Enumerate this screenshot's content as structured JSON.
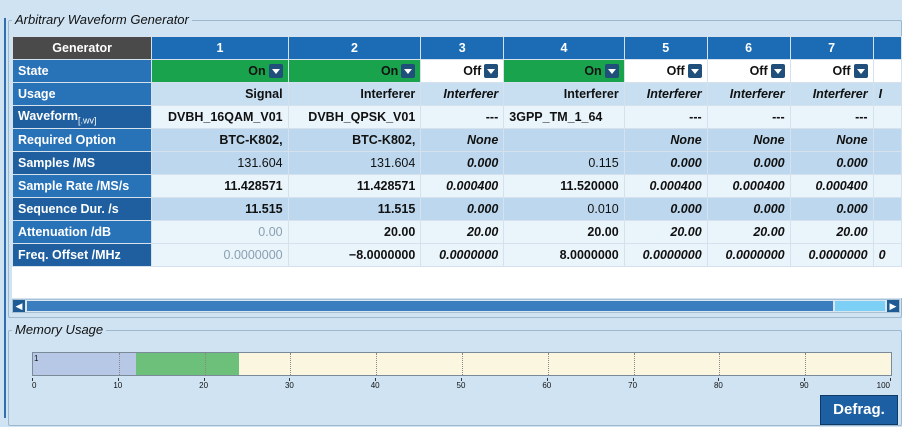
{
  "window": {
    "group_title": "Arbitrary Waveform Generator",
    "memory_title": "Memory Usage",
    "defrag_label": "Defrag."
  },
  "table": {
    "corner": "Generator",
    "columns": [
      "1",
      "2",
      "3",
      "4",
      "5",
      "6",
      "7"
    ],
    "rows": {
      "state": {
        "label": "State",
        "values": [
          "On",
          "On",
          "Off",
          "On",
          "Off",
          "Off",
          "Off"
        ]
      },
      "usage": {
        "label": "Usage",
        "values": [
          "Signal",
          "Interferer",
          "Interferer",
          "Interferer",
          "Interferer",
          "Interferer",
          "Interferer"
        ],
        "partial_next": "I"
      },
      "waveform": {
        "label": "Waveform",
        "label_sub": "[.wv]",
        "values": [
          "DVBH_16QAM_V01",
          "DVBH_QPSK_V01",
          "---",
          "3GPP_TM_1_64",
          "---",
          "---",
          "---"
        ]
      },
      "required_option": {
        "label": "Required Option",
        "values": [
          "BTC-K802,",
          "BTC-K802,",
          "None",
          "",
          "None",
          "None",
          "None"
        ]
      },
      "samples": {
        "label": "Samples /MS",
        "values": [
          "131.604",
          "131.604",
          "0.000",
          "0.115",
          "0.000",
          "0.000",
          "0.000"
        ]
      },
      "sample_rate": {
        "label": "Sample Rate /MS/s",
        "values": [
          "11.428571",
          "11.428571",
          "0.000400",
          "11.520000",
          "0.000400",
          "0.000400",
          "0.000400"
        ]
      },
      "sequence_dur": {
        "label": "Sequence Dur. /s",
        "values": [
          "11.515",
          "11.515",
          "0.000",
          "0.010",
          "0.000",
          "0.000",
          "0.000"
        ]
      },
      "attenuation": {
        "label": "Attenuation /dB",
        "values": [
          "0.00",
          "20.00",
          "20.00",
          "20.00",
          "20.00",
          "20.00",
          "20.00"
        ]
      },
      "freq_offset": {
        "label": "Freq. Offset /MHz",
        "values": [
          "0.0000000",
          "−8.0000000",
          "0.0000000",
          "8.0000000",
          "0.0000000",
          "0.0000000",
          "0.0000000"
        ],
        "partial_next": "0"
      }
    }
  },
  "memory": {
    "segments": [
      {
        "label": "1",
        "from": 0,
        "to": 12,
        "color": "#b7c8e6"
      },
      {
        "label": "",
        "from": 12,
        "to": 24,
        "color": "#6cc07a"
      }
    ],
    "ticks": [
      "0",
      "10",
      "20",
      "30",
      "40",
      "50",
      "60",
      "70",
      "80",
      "90",
      "100"
    ]
  },
  "scrollbar": {
    "left_arrow": "◀",
    "right_arrow": "▶"
  }
}
